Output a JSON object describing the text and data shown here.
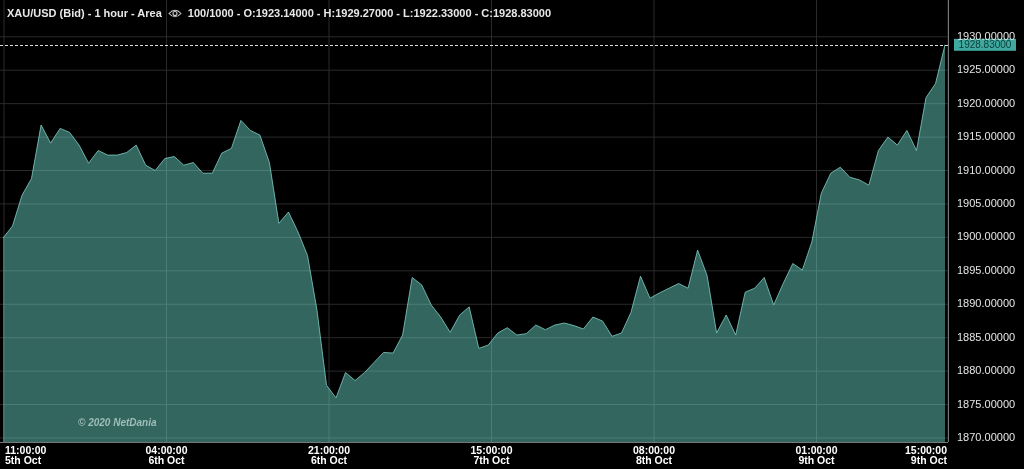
{
  "header": {
    "title": "XAU/USD (Bid) - 1 hour - Area",
    "info": "100/1000 - O:1923.14000 - H:1929.27000 - L:1922.33000 - C:1928.83000"
  },
  "copyright": "© 2020 NetDania",
  "chart_data": {
    "type": "area",
    "ylim": [
      1869.4,
      1935.5
    ],
    "yticks": [
      {
        "value": 1870,
        "label": "1870.00000"
      },
      {
        "value": 1875,
        "label": "1875.00000"
      },
      {
        "value": 1880,
        "label": "1880.00000"
      },
      {
        "value": 1885,
        "label": "1885.00000"
      },
      {
        "value": 1890,
        "label": "1890.00000"
      },
      {
        "value": 1895,
        "label": "1895.00000"
      },
      {
        "value": 1900,
        "label": "1900.00000"
      },
      {
        "value": 1905,
        "label": "1905.00000"
      },
      {
        "value": 1910,
        "label": "1910.00000"
      },
      {
        "value": 1915,
        "label": "1915.00000"
      },
      {
        "value": 1920,
        "label": "1920.00000"
      },
      {
        "value": 1925,
        "label": "1925.00000"
      },
      {
        "value": 1930,
        "label": "1930.00000"
      }
    ],
    "grid": true,
    "series": [
      {
        "color": "#7fcfc6",
        "values": [
          1899.9,
          1901.7,
          1906.3,
          1908.8,
          1916.8,
          1914.1,
          1916.3,
          1915.7,
          1913.8,
          1911.1,
          1913,
          1912.3,
          1912.3,
          1912.7,
          1913.8,
          1910.8,
          1910,
          1911.8,
          1912.1,
          1910.8,
          1911.2,
          1909.6,
          1909.6,
          1912.6,
          1913.3,
          1917.5,
          1916,
          1915.3,
          1911.2,
          1902.1,
          1903.8,
          1900.8,
          1897.3,
          1889.1,
          1877.9,
          1876,
          1879.8,
          1878.6,
          1879.8,
          1881.3,
          1882.8,
          1882.7,
          1885.4,
          1894,
          1892.9,
          1889.9,
          1888.1,
          1885.8,
          1888.4,
          1889.6,
          1883.4,
          1883.9,
          1885.7,
          1886.5,
          1885.4,
          1885.6,
          1886.9,
          1886.2,
          1886.9,
          1887.2,
          1886.8,
          1886.3,
          1888.1,
          1887.5,
          1885.2,
          1885.7,
          1888.8,
          1894.2,
          1890.9,
          1891.7,
          1892.4,
          1893.1,
          1892.4,
          1898.1,
          1894.3,
          1885.7,
          1888.4,
          1885.4,
          1891.8,
          1892.4,
          1894,
          1889.9,
          1893.1,
          1896.1,
          1895.1,
          1899.3,
          1906.6,
          1909.6,
          1910.5,
          1909,
          1908.6,
          1907.8,
          1913,
          1915,
          1913.8,
          1916,
          1913,
          1920.9,
          1923,
          1928.8
        ]
      }
    ]
  },
  "last_price_label": "1928.83000",
  "x_axis_labels": [
    "11:00:00 5th Oct",
    "04:00:00 6th Oct",
    "21:00:00 6th Oct",
    "15:00:00 7th Oct",
    "08:00:00 8th Oct",
    "01:00:00 9th Oct",
    "15:00:00 9th Oct"
  ]
}
